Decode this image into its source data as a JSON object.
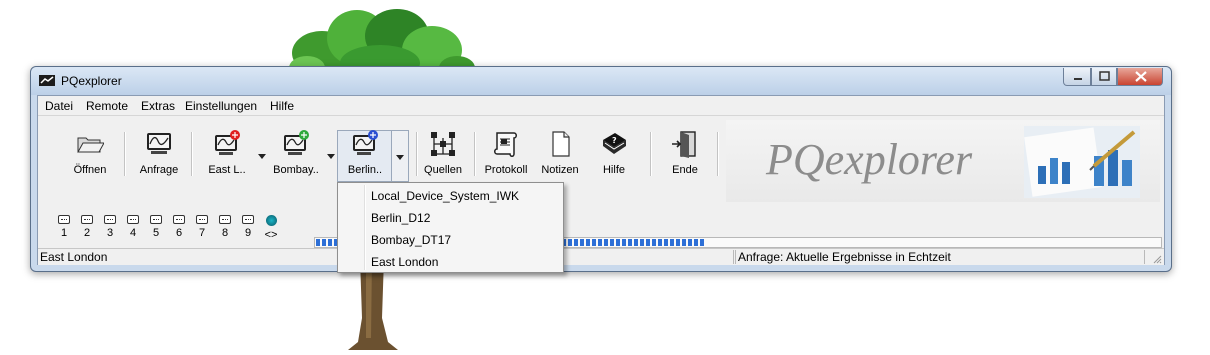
{
  "window": {
    "title": "PQexplorer",
    "controls": {
      "minimize": "minimize-icon",
      "maximize": "maximize-icon",
      "close": "close-icon"
    }
  },
  "menubar": {
    "items": [
      "Datei",
      "Remote",
      "Extras",
      "Einstellungen",
      "Hilfe"
    ]
  },
  "toolbar": {
    "buttons": [
      {
        "label": "Öffnen",
        "icon": "folder-open-icon"
      },
      {
        "label": "Anfrage",
        "icon": "monitor-icon"
      },
      {
        "label": "East L..",
        "icon": "monitor-red-icon"
      },
      {
        "label": "Bombay..",
        "icon": "monitor-green-icon"
      },
      {
        "label": "Berlin..",
        "icon": "monitor-blue-icon"
      },
      {
        "label": "Quellen",
        "icon": "network-icon"
      },
      {
        "label": "Protokoll",
        "icon": "scroll-icon"
      },
      {
        "label": "Notizen",
        "icon": "note-icon"
      },
      {
        "label": "Hilfe",
        "icon": "help-book-icon"
      },
      {
        "label": "Ende",
        "icon": "exit-door-icon"
      }
    ],
    "banner_text": "PQexplorer"
  },
  "channels": {
    "labels": [
      "1",
      "2",
      "3",
      "4",
      "5",
      "6",
      "7",
      "8",
      "9",
      "<>"
    ]
  },
  "progress": {
    "fraction": 0.46
  },
  "statusbar": {
    "left": "East London",
    "right": "Anfrage: Aktuelle Ergebnisse in Echtzeit"
  },
  "dropdown": {
    "items": [
      "Local_Device_System_IWK",
      "Berlin_D12",
      "Bombay_DT17",
      "East London"
    ]
  },
  "colors": {
    "red_badge": "#e02020",
    "green_badge": "#2fa83a",
    "blue_badge": "#2a4fd1",
    "progress": "#2d6fd6"
  }
}
